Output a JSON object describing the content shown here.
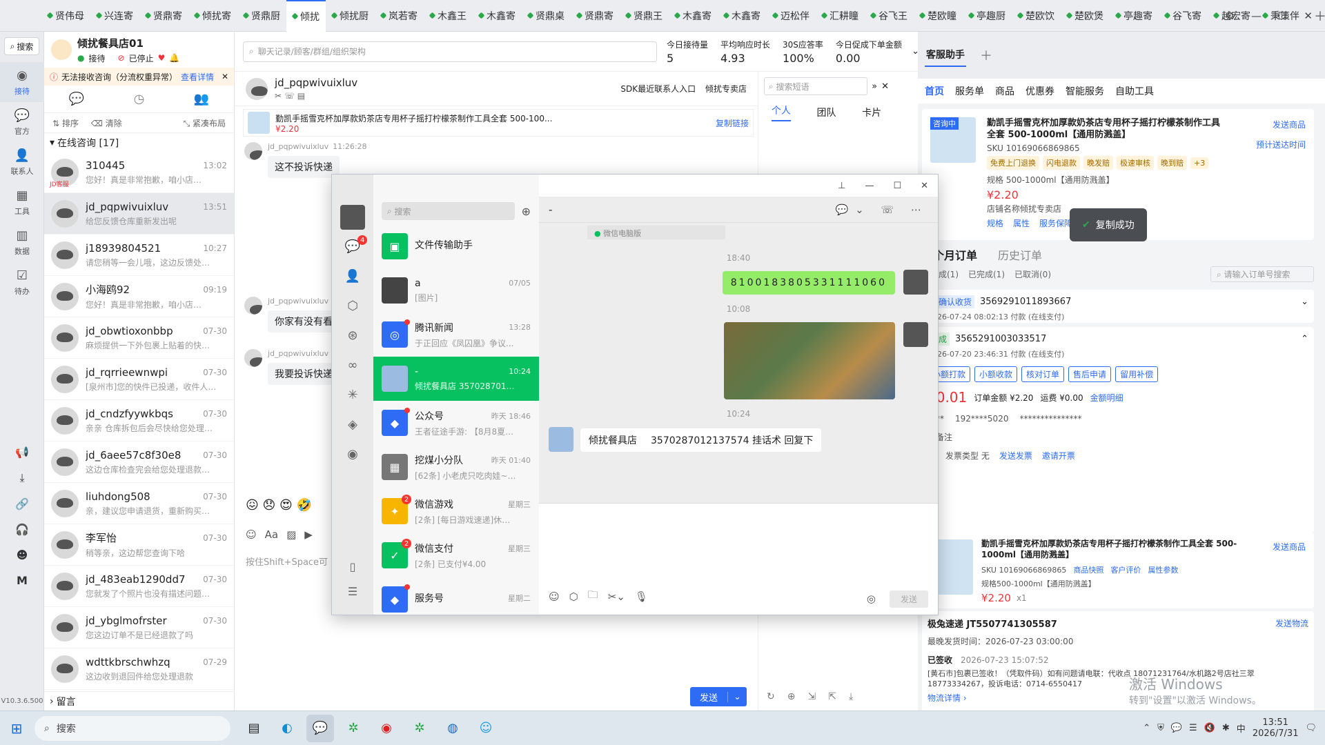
{
  "top_tabs": [
    "贤伟母",
    "兴连寄",
    "贤鼎寄",
    "倾扰寄",
    "贤鼎厨",
    "倾扰",
    "倾扰厨",
    "岚若寄",
    "木鑫王",
    "木鑫寄",
    "贤鼎桌",
    "贤鼎寄",
    "贤鼎王",
    "木鑫寄",
    "木鑫寄",
    "迈松伴",
    "汇耕瞳",
    "谷飞王",
    "楚欧瞳",
    "亭趣厨",
    "楚欧饮",
    "楚欧煲",
    "亭趣寄",
    "谷飞寄",
    "越宏寄",
    "秉策伴"
  ],
  "active_tab_index": 5,
  "rail": {
    "search": "搜索",
    "items": [
      "接待",
      "官方",
      "联系人",
      "工具",
      "数据",
      "待办"
    ],
    "version": "V10.3.6.500"
  },
  "store": {
    "name": "倾扰餐具店01",
    "status_recv": "接待",
    "status_stop": "已停止"
  },
  "alert": {
    "text": "无法接收咨询（分流权重异常）",
    "link": "查看详情"
  },
  "toolbar": {
    "sort": "排序",
    "clear": "清除",
    "layout": "紧凑布局"
  },
  "online_group": "在线咨询 [17]",
  "convs": [
    {
      "name": "310445",
      "time": "13:02",
      "prev": "您好！真是非常抱歉，咱小店…",
      "tag": "JD客服"
    },
    {
      "name": "jd_pqpwivuixluv",
      "time": "13:51",
      "prev": "给您反馈仓库重新发出呢"
    },
    {
      "name": "j18939804521",
      "time": "10:27",
      "prev": "请您稍等一会儿哦，这边反馈处…"
    },
    {
      "name": "小海鸥92",
      "time": "09:19",
      "prev": "您好！真是非常抱歉，咱小店…"
    },
    {
      "name": "jd_obwtioxonbbp",
      "time": "07-30",
      "prev": "麻烦提供一下外包裹上贴着的快…"
    },
    {
      "name": "jd_rqrrieewnwpi",
      "time": "07-30",
      "prev": "[泉州市]您的快件已投递，收件人…"
    },
    {
      "name": "jd_cndzfyywkbqs",
      "time": "07-30",
      "prev": "亲亲 仓库拆包后会尽快给您处理…"
    },
    {
      "name": "jd_6aee57c8f30e8",
      "time": "07-30",
      "prev": "这边仓库检查完会给您处理退款…"
    },
    {
      "name": "liuhdong508",
      "time": "07-30",
      "prev": "亲，建议您申请退货，重新购买…"
    },
    {
      "name": "李军怡",
      "time": "07-30",
      "prev": "稍等亲，这边帮您查询下哈"
    },
    {
      "name": "jd_483eab1290dd7",
      "time": "07-30",
      "prev": "您就发了个照片也没有描述问题…"
    },
    {
      "name": "jd_ybglmofrster",
      "time": "07-30",
      "prev": "您这边订单不是已经退款了吗"
    },
    {
      "name": "wdttkbrschwhzq",
      "time": "07-29",
      "prev": "这边收到退回件给您处理退款"
    }
  ],
  "leave_msg": "留言",
  "chat": {
    "search_placeholder": "聊天记录/顾客/群组/组织架构",
    "stats": [
      {
        "label": "今日接待量",
        "value": "5"
      },
      {
        "label": "平均响应时长",
        "value": "4.93"
      },
      {
        "label": "30S应答率",
        "value": "100%"
      },
      {
        "label": "今日促成下单金额",
        "value": "0.00"
      }
    ],
    "customer": "jd_pqpwivuixluv",
    "sdk": "SDK最近联系人入口",
    "shop": "倾扰专卖店",
    "product_title": "勤凯手摇雪克杯加厚款奶茶店专用杯子摇打柠檬茶制作工具全套 500-100...",
    "product_price": "¥2.20",
    "copy_link": "复制链接",
    "msgs": [
      {
        "sender": "jd_pqpwivuixluv",
        "time": "11:26:28",
        "text": "这不投诉快递"
      },
      {
        "sender": "jd_pqpwivuixluv",
        "time": "",
        "text": "你家有没有看"
      },
      {
        "sender": "jd_pqpwivuixluv",
        "time": "",
        "text": "我要投诉快递"
      }
    ],
    "input_hint": "按住Shift+Space可",
    "send": "发送",
    "phrase_search": "搜索短语",
    "phrase_tabs": [
      "个人",
      "团队",
      "卡片"
    ]
  },
  "wechat": {
    "search": "搜索",
    "convs": [
      {
        "name": "文件传输助手",
        "time": "",
        "prev": "",
        "color": "#07c160",
        "glyph": "▣"
      },
      {
        "name": "a",
        "time": "07/05",
        "prev": "[图片]",
        "color": "#444",
        "glyph": ""
      },
      {
        "name": "腾讯新闻",
        "time": "13:28",
        "prev": "于正回应《凤囚凰》争议...",
        "color": "#2f6cf6",
        "glyph": "◎"
      },
      {
        "name": "-",
        "time": "10:24",
        "prev": "倾扰餐具店   35702870121...",
        "color": "#9bbbe0",
        "glyph": ""
      },
      {
        "name": "公众号",
        "time": "昨天 18:46",
        "prev": "王者征途手游: 【8月8夏日盛...",
        "color": "#2f6cf6",
        "glyph": "◆"
      },
      {
        "name": "挖煤小分队",
        "time": "昨天 01:40",
        "prev": "[62条] 小老虎只吃肉娃~：...",
        "color": "#777",
        "glyph": "▦"
      },
      {
        "name": "微信游戏",
        "time": "星期三",
        "prev": "[2条] [每日游戏速递]休闲与塔...",
        "color": "#f7b500",
        "glyph": "✦"
      },
      {
        "name": "微信支付",
        "time": "星期三",
        "prev": "[2条] 已支付¥4.00",
        "color": "#07c160",
        "glyph": "✓"
      },
      {
        "name": "服务号",
        "time": "星期二",
        "prev": "",
        "color": "#2f6cf6",
        "glyph": "◆"
      }
    ],
    "chat_title": "-",
    "source": "微信电脑版",
    "t1": "18:40",
    "number_msg": "8100183805331111060",
    "t2": "10:08",
    "t3": "10:24",
    "last_msg_name": "倾扰餐具店",
    "last_msg": "3570287012137574  挂话术 回复下",
    "send": "发送"
  },
  "assistant": {
    "tab": "客服助手",
    "nav": [
      "首页",
      "服务单",
      "商品",
      "优惠券",
      "智能服务",
      "自助工具"
    ],
    "product1": {
      "tag": "咨询中",
      "title": "勤凯手摇雪克杯加厚款奶茶店专用杯子摇打柠檬茶制作工具全套 500-1000ml【通用防溅盖】",
      "sku": "SKU 10169066869865",
      "tags": [
        "免费上门退换",
        "闪电退款",
        "晚发赔",
        "极速审核",
        "晚到赔",
        "+3"
      ],
      "spec": "规格 500-1000ml【通用防溅盖】",
      "price": "¥2.20",
      "shop": "店铺名称倾扰专卖店",
      "links": [
        "规格",
        "属性",
        "服务保障",
        "评价"
      ],
      "send": "发送商品",
      "ship": "预计送达时间"
    },
    "toast": "复制成功",
    "order_tabs": [
      "三个月订单",
      "历史订单"
    ],
    "order_subtabs": [
      "未完成(1)",
      "已完成(1)",
      "已取消(0)"
    ],
    "order_search": "请输入订单号搜索",
    "order1": {
      "status": "待确认收货",
      "no": "3569291011893667",
      "time": "2026-07-24 08:02:13 付款 (在线支付)"
    },
    "order2": {
      "status": "完成",
      "no": "3565291003033517",
      "time": "2026-07-20 23:46:31 付款 (在线支付)",
      "btns": [
        "小额打款",
        "小额收款",
        "核对订单",
        "售后申请",
        "留用补偿"
      ],
      "pay": "¥0.01",
      "total": "订单金额 ¥2.20",
      "freight": "运费 ¥0.00",
      "detail": "金额明细",
      "info": "智**",
      "phone": "192****5020",
      "remark": "家备注",
      "state": "无",
      "invoice": "发票类型 无",
      "send_inv": "发送发票",
      "invite": "邀请开票"
    },
    "product2": {
      "title": "勤凯手摇雪克杯加厚款奶茶店专用杯子摇打柠檬茶制作工具全套 500-1000ml【通用防溅盖】",
      "sku": "SKU 10169066869865",
      "links": [
        "商品快照",
        "客户评价",
        "属性参数"
      ],
      "spec": "规格500-1000ml【通用防溅盖】",
      "price": "¥2.20",
      "qty": "x1",
      "send": "发送商品"
    },
    "logistics": {
      "title": "极兔速递 JT5507741305587",
      "send": "发送物流",
      "latest": "最晚发货时间：2026-07-23 03:00:00",
      "signed": "已签收",
      "signed_time": "2026-07-23 15:07:52",
      "desc": "[黄石市]包裹已签收！（凭取件码）如有问题请电联：代收点 18071231764/水机路2号店社三翠 18773334267，投诉电话：0714-6550417",
      "detail": "物流详情"
    },
    "watermark1": "激活 Windows",
    "watermark2": "转到\"设置\"以激活 Windows。"
  },
  "taskbar": {
    "search": "搜索",
    "time": "13:51",
    "date": "2026/7/31",
    "ime": "中"
  }
}
